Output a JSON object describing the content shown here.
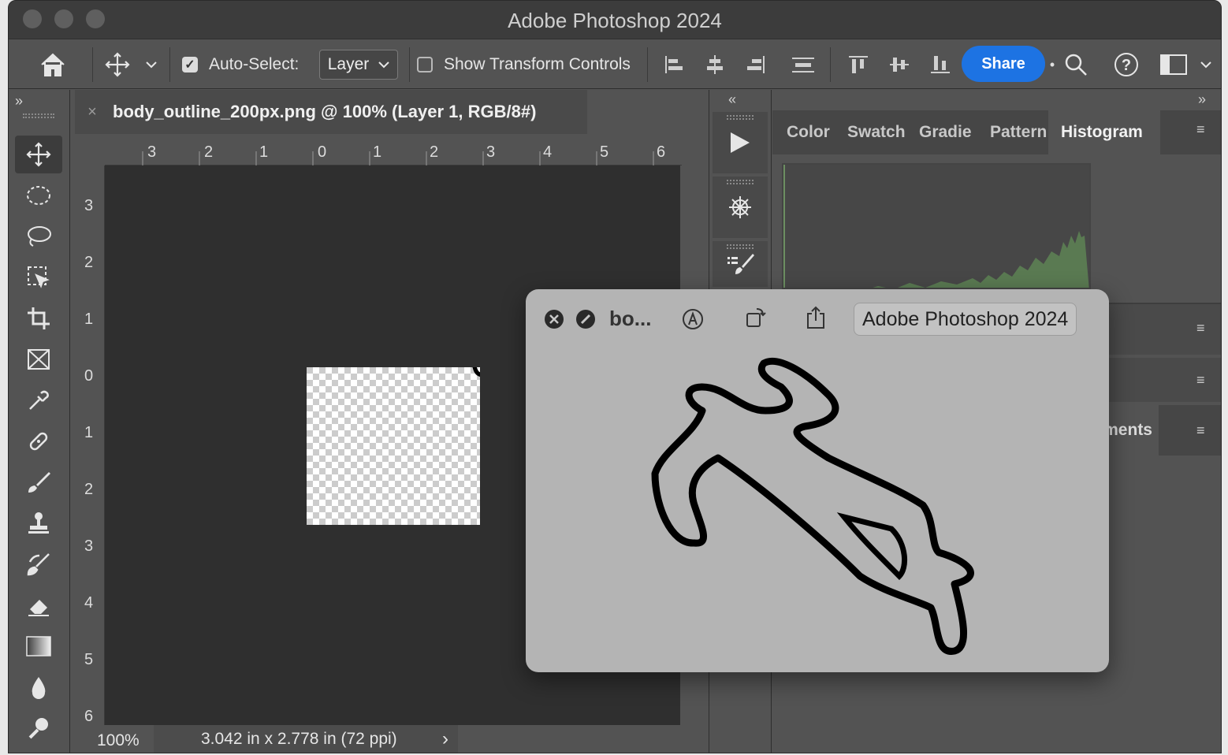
{
  "window": {
    "title": "Adobe Photoshop 2024"
  },
  "options_bar": {
    "auto_select_label": "Auto-Select:",
    "auto_select_checked": true,
    "layer_select_value": "Layer",
    "transform_controls_label": "Show Transform Controls",
    "transform_controls_checked": false,
    "share_label": "Share",
    "share_color": "#1d73e3"
  },
  "document": {
    "tab_title": "body_outline_200px.png @ 100% (Layer 1, RGB/8#)",
    "h_ruler_labels": [
      "3",
      "2",
      "1",
      "0",
      "1",
      "2",
      "3",
      "4",
      "5",
      "6"
    ],
    "v_ruler_labels": [
      "3",
      "2",
      "1",
      "0",
      "1",
      "2",
      "3",
      "4",
      "5",
      "6"
    ],
    "zoom": "100%",
    "doc_info": "3.042 in x 2.778 in (72 ppi)"
  },
  "panels": {
    "tabs": [
      "Color",
      "Swatch",
      "Gradie",
      "Pattern",
      "Histogram"
    ],
    "active_tab": "Histogram",
    "partial_label": "tments"
  },
  "quicklook": {
    "file_name": "bo...",
    "open_with": "Adobe Photoshop 2024"
  }
}
